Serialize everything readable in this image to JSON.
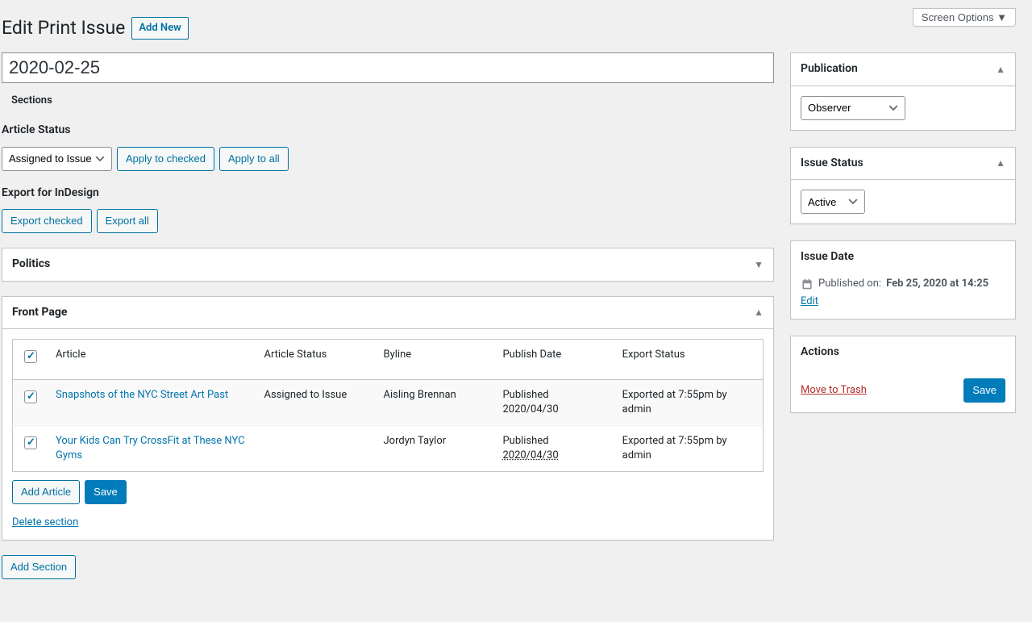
{
  "screen_options_label": "Screen Options ▼",
  "heading": "Edit Print Issue",
  "add_new_label": "Add New",
  "title_value": "2020-02-25",
  "sections_label": "Sections",
  "article_status_heading": "Article Status",
  "article_status_select": "Assigned to Issue",
  "apply_to_checked_label": "Apply to checked",
  "apply_to_all_label": "Apply to all",
  "export_heading": "Export for InDesign",
  "export_checked_label": "Export checked",
  "export_all_label": "Export all",
  "politics_section_title": "Politics",
  "front_page_section_title": "Front Page",
  "table_headers": {
    "article": "Article",
    "status": "Article Status",
    "byline": "Byline",
    "publish_date": "Publish Date",
    "export_status": "Export Status"
  },
  "rows": [
    {
      "title": "Snapshots of the NYC Street Art Past",
      "status": "Assigned to Issue",
      "byline": "Aisling Brennan",
      "publish_line1": "Published",
      "publish_line2": "2020/04/30",
      "publish_dotted": false,
      "export_status": "Exported at 7:55pm by admin"
    },
    {
      "title": "Your Kids Can Try CrossFit at These NYC Gyms",
      "status": "",
      "byline": "Jordyn Taylor",
      "publish_line1": "Published",
      "publish_line2": "2020/04/30",
      "publish_dotted": true,
      "export_status": "Exported at 7:55pm by admin"
    }
  ],
  "add_article_label": "Add Article",
  "save_label": "Save",
  "delete_section_label": "Delete section",
  "add_section_label": "Add Section",
  "sidebar": {
    "publication": {
      "title": "Publication",
      "value": "Observer"
    },
    "issue_status": {
      "title": "Issue Status",
      "value": "Active"
    },
    "issue_date": {
      "title": "Issue Date",
      "published_label": "Published on:",
      "published_value": "Feb 25, 2020 at 14:25",
      "edit_label": "Edit"
    },
    "actions": {
      "title": "Actions",
      "trash_label": "Move to Trash",
      "save_label": "Save"
    }
  }
}
